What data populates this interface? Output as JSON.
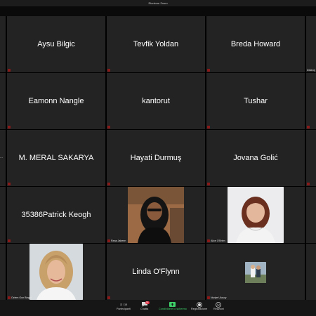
{
  "window": {
    "title": "Riunione Zoom"
  },
  "participants": [
    {
      "name": "Aysu Bilgic"
    },
    {
      "name": "Tevfik Yoldan"
    },
    {
      "name": "Breda Howard"
    },
    {
      "name": "Eamonn Nangle"
    },
    {
      "name": "kantorut"
    },
    {
      "name": "Tushar"
    },
    {
      "name": "M. MERAL SAKARYA"
    },
    {
      "name": "Hayati Durmuş"
    },
    {
      "name": "Jovana Golić"
    },
    {
      "name": "35386Patrick Keogh"
    },
    {
      "name": "Rana Jabeen"
    },
    {
      "name": "Alice O'Brien"
    },
    {
      "name": "Ozlem Gun Bingol"
    },
    {
      "name": "Linda O'Flynn"
    },
    {
      "name": "Nuriye Ulusoy"
    }
  ],
  "edge": {
    "right_label": "Delaroj",
    "left_dots": "..."
  },
  "toolbar": {
    "participants_label": "Partecipanti",
    "participants_count": "118",
    "chat_label": "Chatta",
    "chat_badge": "25",
    "share_label": "Condividere lo schermo",
    "record_label": "Registrazione",
    "reactions_label": "Reazioni"
  },
  "colors": {
    "tile_bg": "#232323",
    "mute_red": "#8a1a1a",
    "share_green": "#3ed16a",
    "badge_red": "#e0243a"
  }
}
